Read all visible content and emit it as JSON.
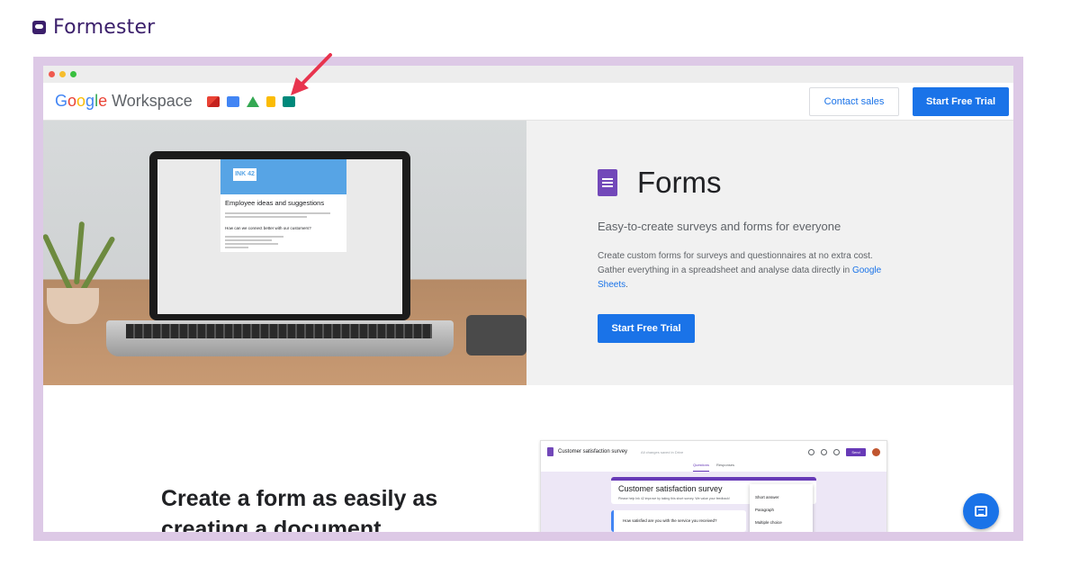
{
  "brand": {
    "name": "Formester"
  },
  "header": {
    "logo_google": "Google",
    "logo_workspace": " Workspace",
    "app_icons": [
      "gmail-icon",
      "calendar-icon",
      "drive-icon",
      "docs-icon",
      "meet-icon"
    ],
    "contact_label": "Contact sales",
    "trial_label": "Start Free Trial"
  },
  "hero": {
    "title": "Forms",
    "subtitle": "Easy-to-create surveys and forms for everyone",
    "desc_text": "Create custom forms for surveys and questionnaires at no extra cost. Gather everything in a spreadsheet and analyse data directly in ",
    "desc_link": "Google Sheets",
    "desc_end": ".",
    "cta_label": "Start Free Trial",
    "laptop": {
      "banner": "INK 42",
      "form_title": "Employee ideas and suggestions",
      "question": "How can we connect better with our customers?"
    }
  },
  "section2": {
    "heading": "Create a form as easily as creating a document",
    "mock": {
      "title": "Customer satisfaction survey",
      "saved": "All changes saved in Drive",
      "send": "Send",
      "tabs": [
        "Questions",
        "Responses"
      ],
      "card_title": "Customer satisfaction survey",
      "card_desc": "Please help Ink 42 improve by taking this short survey. We value your feedback!",
      "question": "How satisfied are you with the service you received?",
      "menu": [
        "Short answer",
        "Paragraph",
        "Multiple choice"
      ]
    }
  },
  "colors": {
    "brand": "#3b1f6b",
    "frame": "#ddc9e6",
    "primary": "#1a73e8",
    "forms_purple": "#7248b9",
    "arrow": "#e8344e"
  }
}
